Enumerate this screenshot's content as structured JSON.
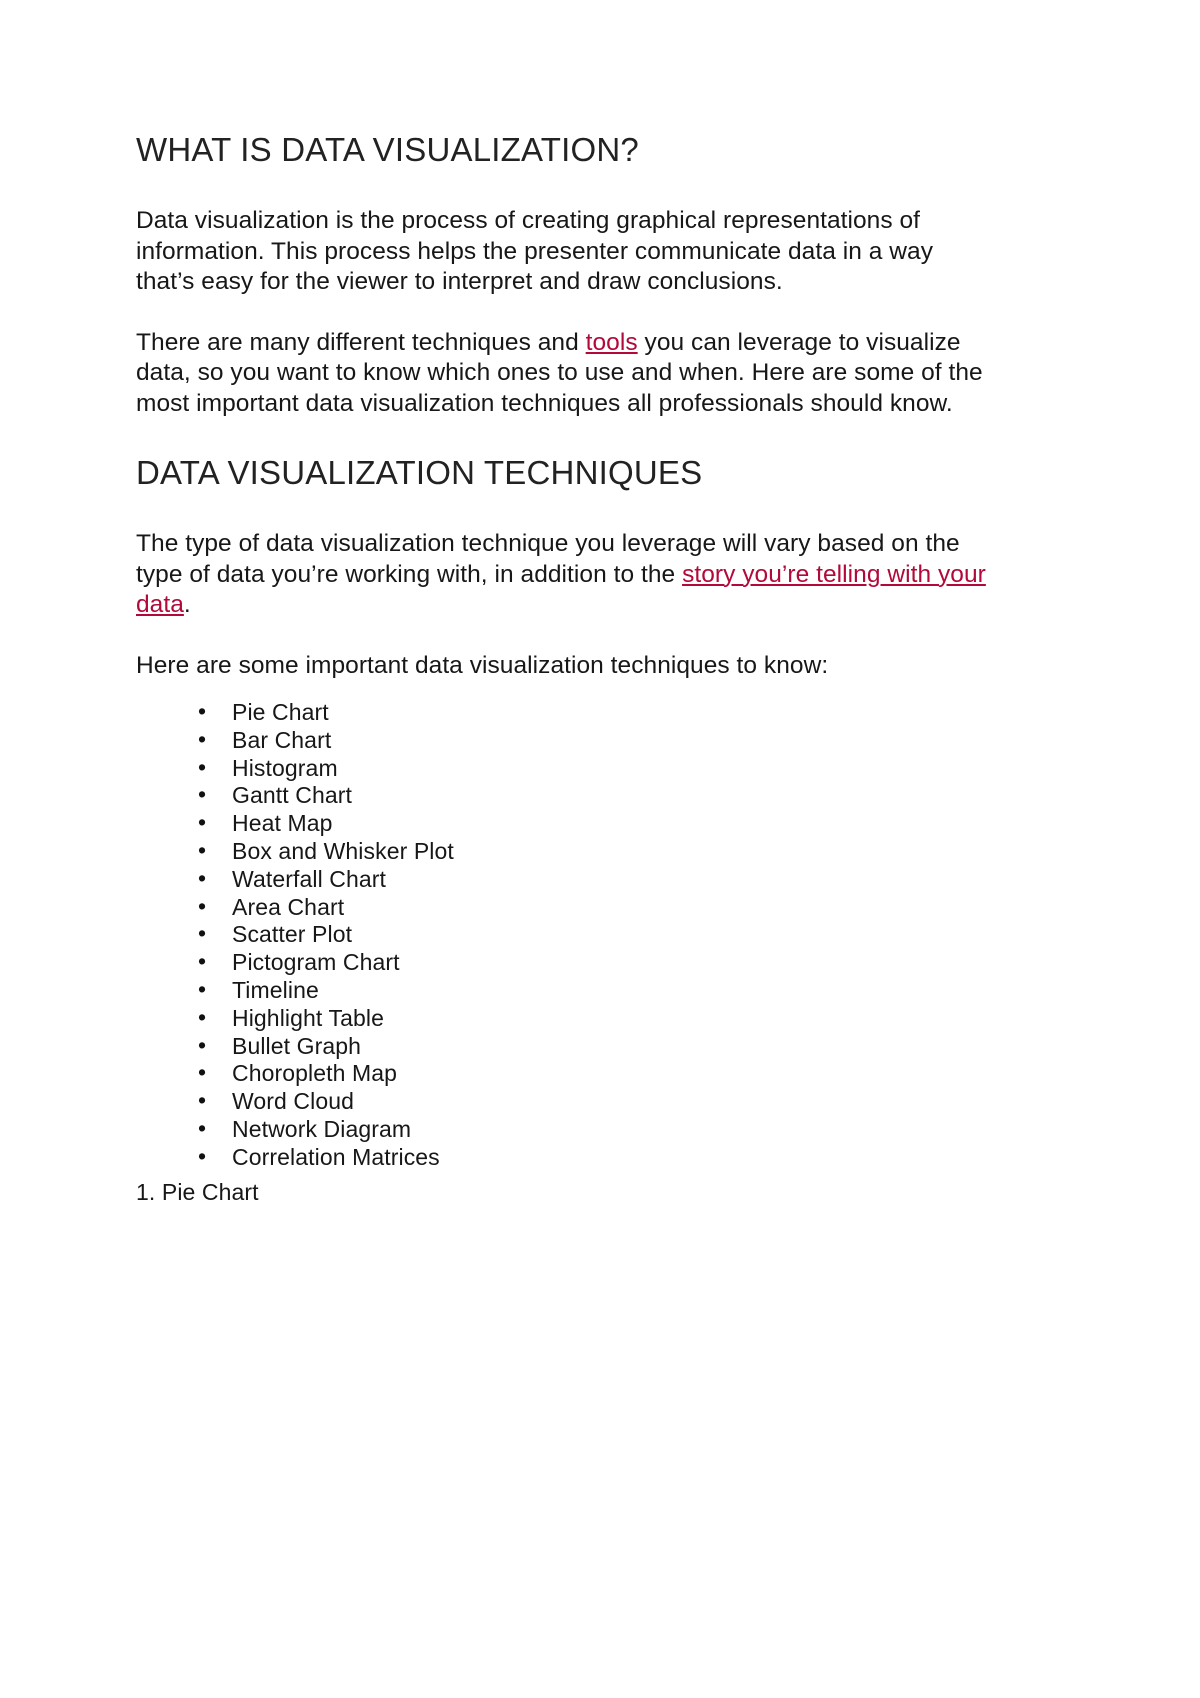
{
  "document": {
    "sections": [
      {
        "heading": "WHAT IS DATA VISUALIZATION?",
        "paragraphs": [
          {
            "parts": [
              {
                "type": "text",
                "value": "Data visualization is the process of creating graphical representations of information. This process helps the presenter communicate data in a way that’s easy for the viewer to interpret and draw conclusions."
              }
            ]
          },
          {
            "parts": [
              {
                "type": "text",
                "value": "There are many different techniques and "
              },
              {
                "type": "link",
                "value": "tools"
              },
              {
                "type": "text",
                "value": " you can leverage to visualize data, so you want to know which ones to use and when. Here are some of the most important data visualization techniques all professionals should know."
              }
            ]
          }
        ]
      },
      {
        "heading": "DATA VISUALIZATION TECHNIQUES",
        "paragraphs": [
          {
            "parts": [
              {
                "type": "text",
                "value": "The type of data visualization technique you leverage will vary based on the type of data you’re working with, in addition to the "
              },
              {
                "type": "link",
                "value": "story you’re telling with your data"
              },
              {
                "type": "text",
                "value": "."
              }
            ]
          },
          {
            "parts": [
              {
                "type": "text",
                "value": "Here are some important data visualization techniques to know:"
              }
            ]
          }
        ]
      }
    ],
    "paragraph_1_text": "Data visualization is the process of creating graphical representations of information. This process helps the presenter communicate data in a way that’s easy for the viewer to interpret and draw conclusions.",
    "paragraph_2": {
      "lead": "There are many different techniques and ",
      "link": "tools",
      "tail": " you can leverage to visualize data, so you want to know which ones to use and when. Here are some of the most important data visualization techniques all professionals should know."
    },
    "paragraph_3": {
      "lead": "The type of data visualization technique you leverage will vary based on the type of data you’re working with, in addition to the ",
      "link": "story you’re telling with your data",
      "tail": "."
    },
    "paragraph_4_text": "Here are some important data visualization techniques to know:",
    "heading_1": "WHAT IS DATA VISUALIZATION?",
    "heading_2": "DATA VISUALIZATION TECHNIQUES",
    "techniques": [
      "Pie Chart",
      "Bar Chart",
      "Histogram",
      "Gantt Chart",
      "Heat Map",
      "Box and Whisker Plot",
      "Waterfall Chart",
      "Area Chart",
      "Scatter Plot",
      "Pictogram Chart",
      "Timeline",
      "Highlight Table",
      "Bullet Graph",
      "Choropleth Map",
      "Word Cloud",
      "Network Diagram",
      "Correlation Matrices"
    ],
    "numbered_item": "1. Pie Chart",
    "colors": {
      "page_background": "#ffffff",
      "body_text": "#171717",
      "heading_text": "#222222",
      "link": "#b2093a"
    }
  }
}
